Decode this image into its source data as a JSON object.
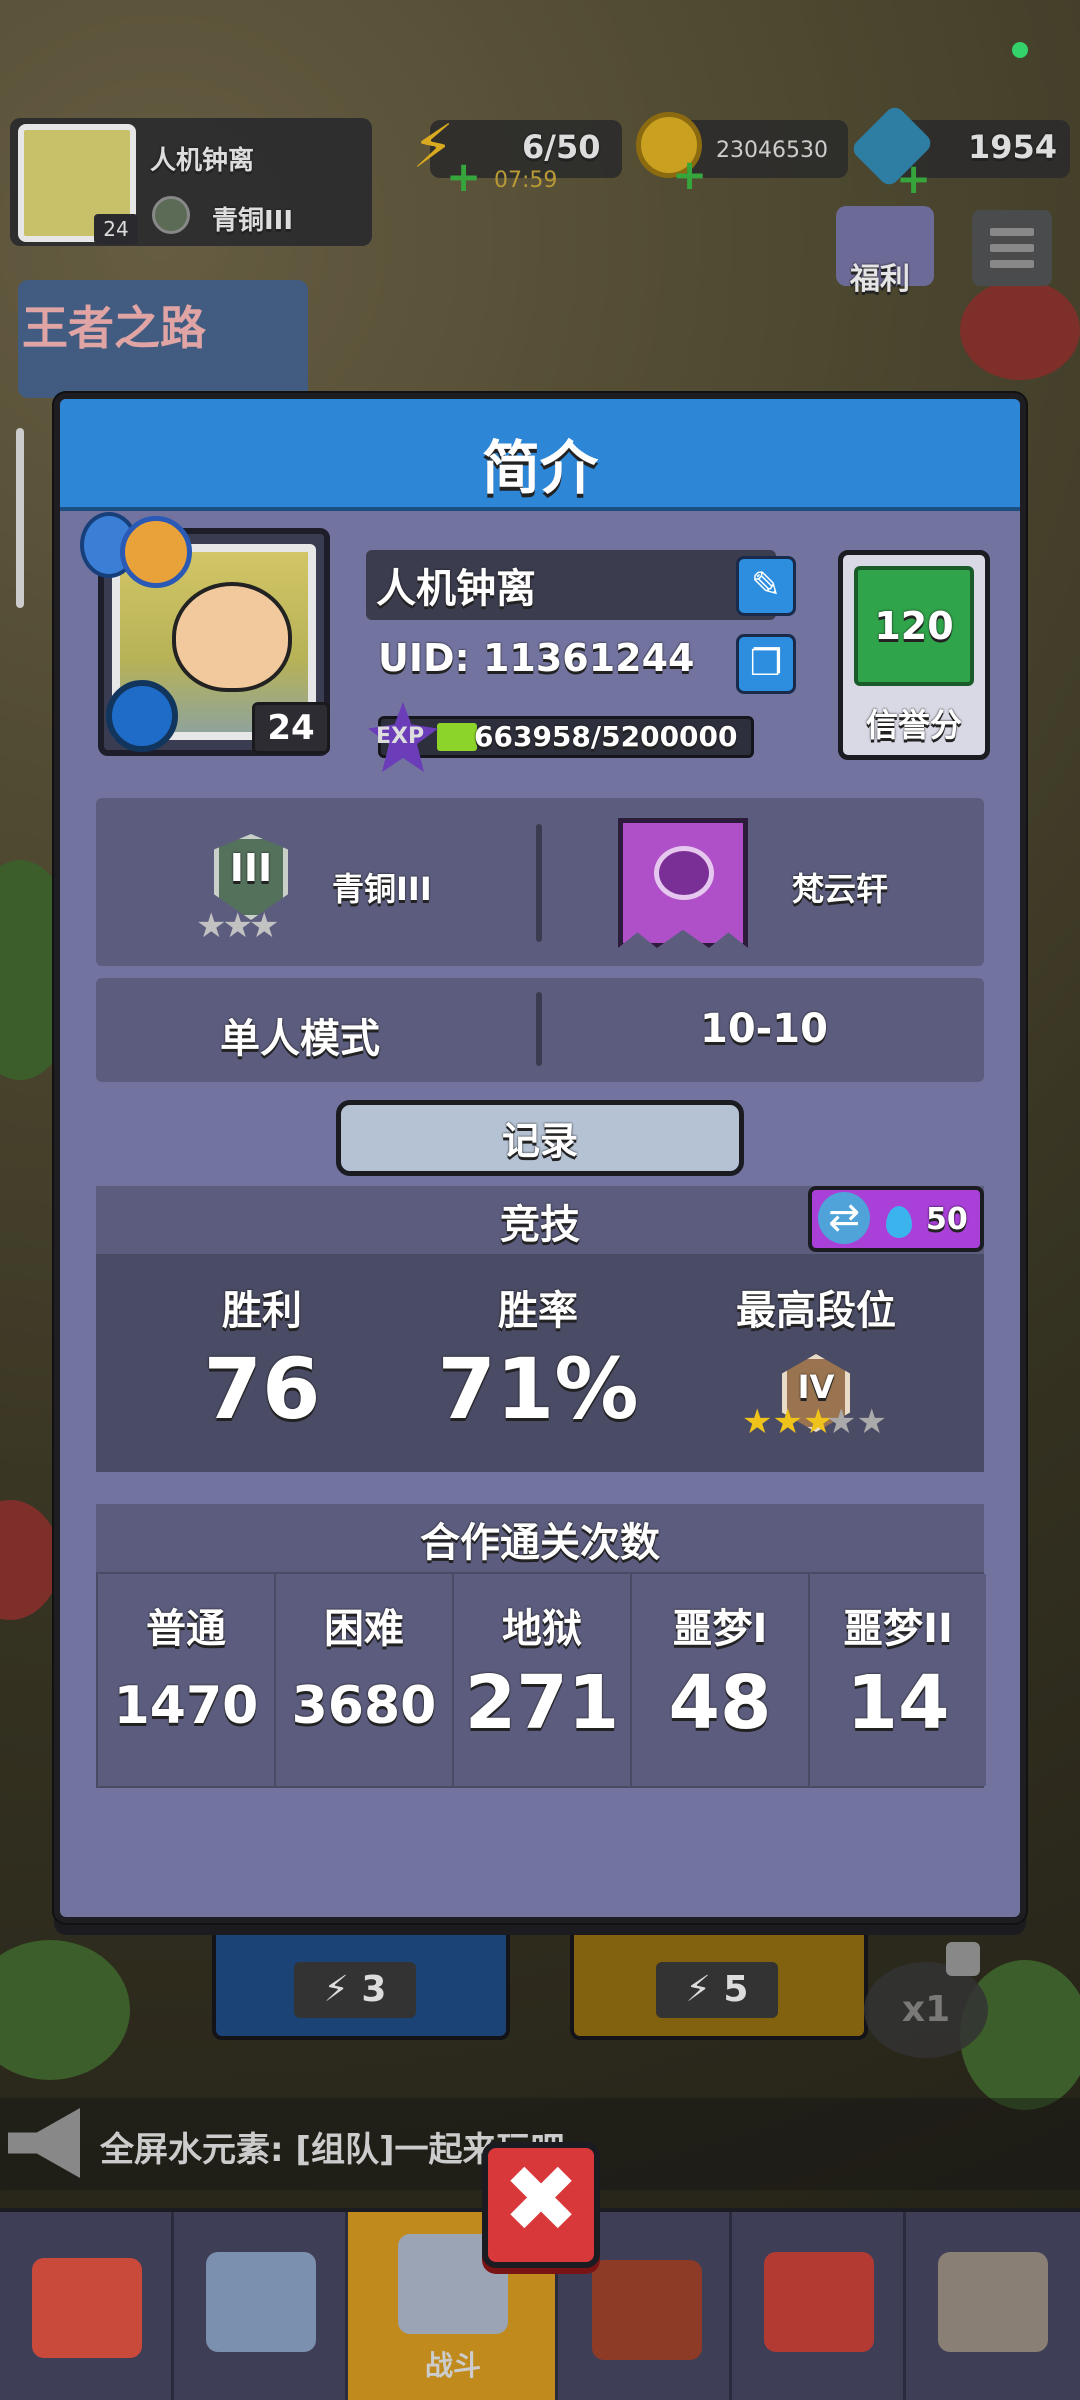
{
  "hud": {
    "player_name": "人机钟离",
    "player_level": "24",
    "player_rank": "青铜III",
    "energy": "6/50",
    "energy_timer": "07:59",
    "coins": "23046530",
    "gems": "1954",
    "gift_label": "福利",
    "banner_left": "王者之路"
  },
  "modal": {
    "title": "简介",
    "avatar_level": "24",
    "name": "人机钟离",
    "uid": "UID: 11361244",
    "exp_label": "EXP",
    "exp_text": "663958/5200000",
    "exp_fraction": 0.1277,
    "credit_value": "120",
    "credit_label": "信誉分",
    "rank_icon_text": "III",
    "rank_name": "青铜III",
    "guild_name": "梵云轩",
    "mode_label": "单人模式",
    "mode_value": "10-10",
    "records_button": "记录"
  },
  "competitive": {
    "title": "竞技",
    "swap_cost": "50",
    "stats": [
      {
        "label": "胜利",
        "value": "76"
      },
      {
        "label": "胜率",
        "value": "71%"
      },
      {
        "label": "最高段位",
        "value": ""
      }
    ],
    "highest_rank_badge": "IV",
    "highest_rank_stars": "3 of 5"
  },
  "coop": {
    "title": "合作通关次数",
    "columns": [
      {
        "label": "普通",
        "value": "1470"
      },
      {
        "label": "困难",
        "value": "3680"
      },
      {
        "label": "地狱",
        "value": "271"
      },
      {
        "label": "噩梦I",
        "value": "48"
      },
      {
        "label": "噩梦II",
        "value": "14"
      }
    ]
  },
  "background_ui": {
    "mode_blue_cost": "3",
    "mode_yellow_cost": "5",
    "multiplier": "x1",
    "marquee": "全屏水元素: [组队]一起来玩吧~",
    "nav_active_label": "战斗"
  },
  "icons": {
    "close": "close-icon",
    "edit": "pencil-icon",
    "copy": "copy-icon",
    "swap": "swap-icon",
    "gem": "water-drop-icon"
  },
  "colors": {
    "header_blue": "#2d86d6",
    "modal_bg": "#72739f",
    "credit_green": "#2fa44a",
    "exp_green": "#8dd42a",
    "swap_purple": "#a940d8",
    "close_red": "#d9383a"
  }
}
